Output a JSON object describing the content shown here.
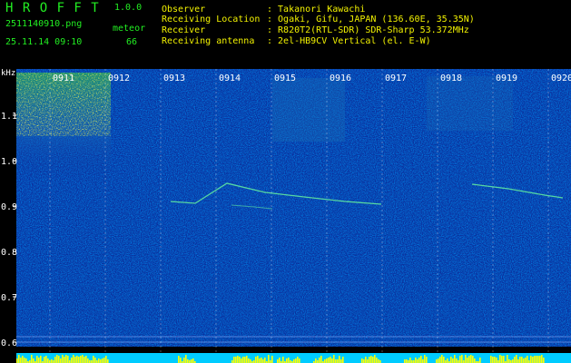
{
  "app": {
    "title": "H R O F F T",
    "version": "1.0.0"
  },
  "file": {
    "name": "2511140910.png",
    "datetime": "25.11.14 09:10"
  },
  "meteor": {
    "label": "meteor",
    "count": "66"
  },
  "info": [
    {
      "label": "Observer",
      "value": ": Takanori Kawachi"
    },
    {
      "label": "Receiving Location",
      "value": ": Ogaki, Gifu, JAPAN (136.60E, 35.35N)"
    },
    {
      "label": "Receiver",
      "value": ": R820T2(RTL-SDR) SDR-Sharp 53.372MHz"
    },
    {
      "label": "Receiving antenna",
      "value": ": 2el-HB9CV Vertical (el. E-W)"
    }
  ],
  "spectrogram": {
    "y_unit": "kHz",
    "y_ticks": [
      "1.1",
      "1.0",
      "0.9",
      "0.8",
      "0.7",
      "0.6"
    ],
    "x_ticks": [
      "0911",
      "0912",
      "0913",
      "0914",
      "0915",
      "0916",
      "0917",
      "0918",
      "0919",
      "0920"
    ]
  },
  "colors": {
    "header_green": "#22ee22",
    "header_yellow": "#f2f200",
    "background": "#000000",
    "spectrum_base": "#0a2f9c",
    "baseline_cyan": "#00ccff",
    "baseline_yellow": "#ffff00"
  }
}
